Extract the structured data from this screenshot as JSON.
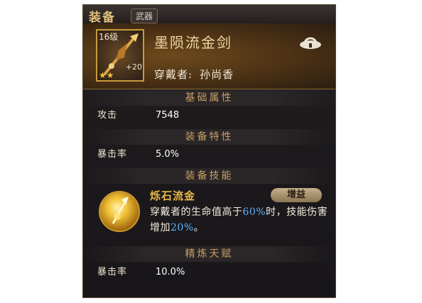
{
  "window": {
    "title": "装备",
    "tag": "武器"
  },
  "item": {
    "level": "16级",
    "enhance": "+20",
    "name": "墨陨流金剑",
    "wearer_label": "穿戴者:",
    "wearer_name": "孙尚香",
    "lock_icon": "lock-icon"
  },
  "sections": {
    "base": "基础属性",
    "trait": "装备特性",
    "skill": "装备技能",
    "refine": "精炼天赋"
  },
  "base_stats": [
    {
      "label": "攻击",
      "value": "7548"
    }
  ],
  "trait_stats": [
    {
      "label": "暴击率",
      "value": "5.0%"
    }
  ],
  "skill": {
    "name": "烁石流金",
    "badge": "增益",
    "desc_part1": "穿戴者的生命值高于",
    "desc_value1": "60%",
    "desc_part2": "时，技能伤害增加",
    "desc_value2": "20%",
    "desc_part3": "。"
  },
  "refine_stats": [
    {
      "label": "暴击率",
      "value": "10.0%"
    }
  ],
  "colors": {
    "highlight": "#5fb3ff",
    "gold": "#e7b84a",
    "panel": "#1d1a1c"
  }
}
